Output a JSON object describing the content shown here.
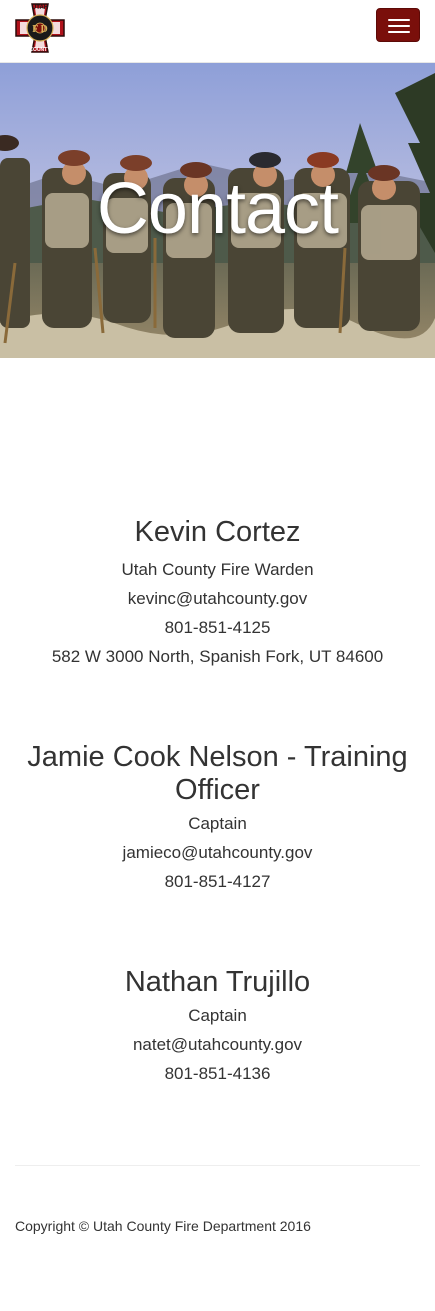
{
  "nav": {
    "logo_top_text": "UTAH",
    "logo_bottom_text": "COUNTY",
    "logo_letters": "F D",
    "menu_icon": "hamburger-icon"
  },
  "hero": {
    "title": "Contact"
  },
  "contacts": [
    {
      "name": "Kevin Cortez",
      "title": "Utah County Fire Warden",
      "email": "kevinc@utahcounty.gov",
      "phone": "801-851-4125",
      "address": "582 W 3000 North, Spanish Fork, UT 84600"
    },
    {
      "name": "Jamie Cook Nelson - Training Officer",
      "title": "Captain",
      "email": "jamieco@utahcounty.gov",
      "phone": "801-851-4127"
    },
    {
      "name": "Nathan Trujillo",
      "title": "Captain",
      "email": "natet@utahcounty.gov",
      "phone": "801-851-4136"
    }
  ],
  "footer": {
    "copyright": "Copyright © Utah County Fire Department 2016"
  },
  "colors": {
    "brand": "#7a0f0b",
    "text": "#333333"
  }
}
